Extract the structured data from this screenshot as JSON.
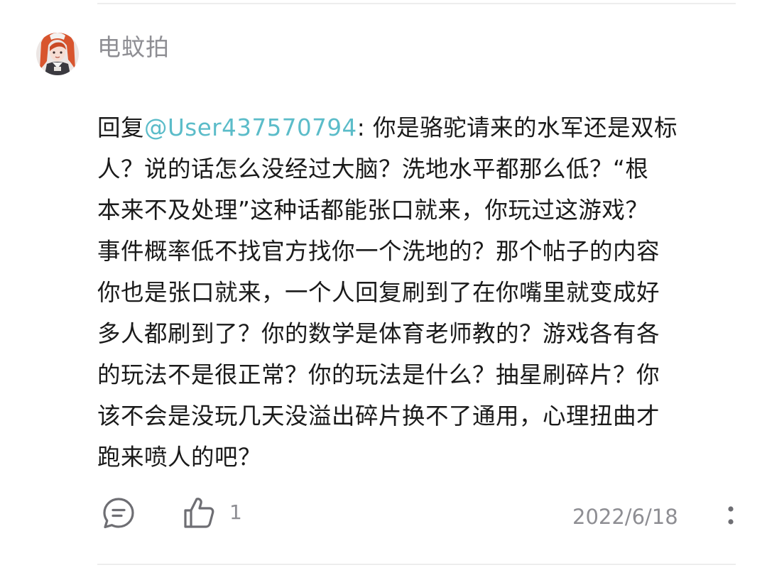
{
  "comment": {
    "username": "电蚊拍",
    "reply_prefix": "回复",
    "mention": "@User437570794",
    "line1_rest": ": 你是骆驼请来的水军还是双标",
    "lines": [
      "人？说的话怎么没经过大脑？洗地水平都那么低？“根",
      "本来不及处理”这种话都能张口就来，你玩过这游戏？",
      "事件概率低不找官方找你一个洗地的？那个帖子的内容",
      "你也是张口就来，一个人回复刷到了在你嘴里就变成好",
      "多人都刷到了？你的数学是体育老师教的？游戏各有各",
      "的玩法不是很正常？你的玩法是什么？抽星刷碎片？你",
      "该不会是没玩几天没溢出碎片换不了通用，心理扭曲才",
      "跑来喷人的吧？"
    ]
  },
  "actions": {
    "reply_icon": "comment-bubble-icon",
    "like_icon": "thumbs-up-icon",
    "like_count": "1",
    "date": "2022/6/18",
    "more_icon": "vertical-dots-icon"
  },
  "colors": {
    "mention": "#5bbcc9",
    "meta_text": "#8e8e93",
    "body_text": "#1a1a1a",
    "divider": "#ededed"
  }
}
